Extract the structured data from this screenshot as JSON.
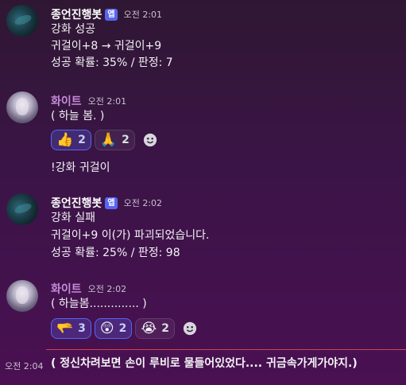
{
  "messages": [
    {
      "author": "종언진행봇",
      "badge": "앱",
      "time": "오전 2:01",
      "lines": [
        "강화 성공",
        "귀걸이+8 → 귀걸이+9",
        "성공 확률: 35% / 판정: 7"
      ]
    },
    {
      "author": "화이트",
      "time": "오전 2:01",
      "lines": [
        "( 하늘 봄. )"
      ],
      "reactions": [
        {
          "emoji": "👍",
          "count": "2",
          "active": true
        },
        {
          "emoji": "🙏",
          "count": "2",
          "active": false
        }
      ],
      "followup": "!강화 귀걸이"
    },
    {
      "author": "종언진행봇",
      "badge": "앱",
      "time": "오전 2:02",
      "lines": [
        "강화 실패",
        "귀걸이+9 이(가) 파괴되었습니다.",
        "성공 확률: 25% / 판정: 98"
      ]
    },
    {
      "author": "화이트",
      "time": "오전 2:02",
      "lines": [
        "( 하늘봄.............. )"
      ],
      "reactions": [
        {
          "emoji": "🫳",
          "count": "3",
          "active": true
        },
        {
          "emoji": "😲",
          "count": "2",
          "active": true
        },
        {
          "emoji": "😭",
          "count": "2",
          "active": false
        }
      ]
    }
  ],
  "compact": {
    "time": "오전 2:04",
    "text": "( 정신차려보면 손이 루비로 물들어있었다.... 귀금속가게가야지.)"
  },
  "add_reaction_icon": "smiley-add-icon",
  "colors": {
    "accent": "#5865f2",
    "new_divider": "#d2444d",
    "white_name": "#c58bd8"
  }
}
